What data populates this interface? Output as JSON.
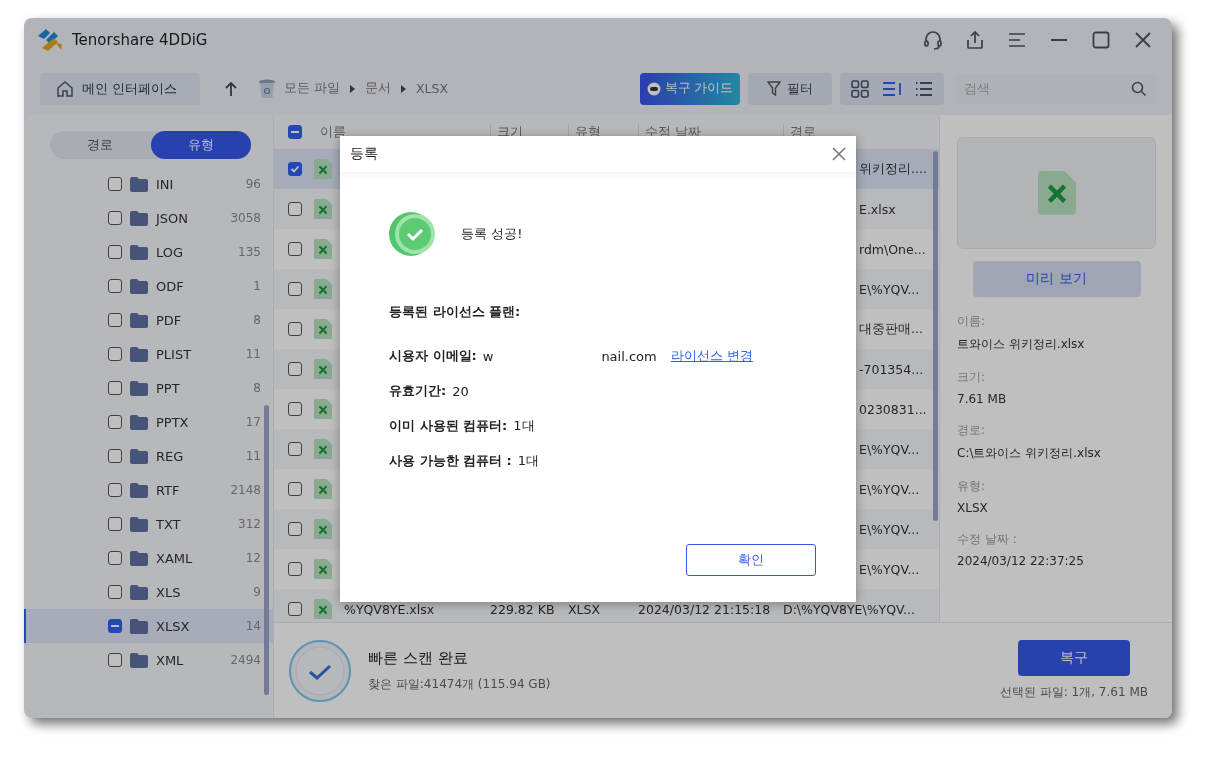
{
  "window": {
    "title": "Tenorshare 4DDiG"
  },
  "toolbar": {
    "home_button": "메인 인터페이스",
    "breadcrumb": [
      "모든 파일",
      "문서",
      "XLSX"
    ],
    "guide_button": "복구 가이드",
    "filter_button": "필터",
    "views": [
      {
        "kind": "grid",
        "selected": false
      },
      {
        "kind": "detail",
        "selected": true
      },
      {
        "kind": "list",
        "selected": false
      }
    ],
    "search": {
      "placeholder": "검색"
    }
  },
  "sidebar": {
    "tabs": [
      {
        "label": "경로",
        "selected": false
      },
      {
        "label": "유형",
        "selected": true
      }
    ],
    "items": [
      {
        "label": "INI",
        "count": "96",
        "checked": false,
        "indeterminate": false,
        "selected": false
      },
      {
        "label": "JSON",
        "count": "3058",
        "checked": false,
        "indeterminate": false,
        "selected": false
      },
      {
        "label": "LOG",
        "count": "135",
        "checked": false,
        "indeterminate": false,
        "selected": false
      },
      {
        "label": "ODF",
        "count": "1",
        "checked": false,
        "indeterminate": false,
        "selected": false
      },
      {
        "label": "PDF",
        "count": "8",
        "checked": false,
        "indeterminate": false,
        "selected": false
      },
      {
        "label": "PLIST",
        "count": "11",
        "checked": false,
        "indeterminate": false,
        "selected": false
      },
      {
        "label": "PPT",
        "count": "8",
        "checked": false,
        "indeterminate": false,
        "selected": false
      },
      {
        "label": "PPTX",
        "count": "17",
        "checked": false,
        "indeterminate": false,
        "selected": false
      },
      {
        "label": "REG",
        "count": "11",
        "checked": false,
        "indeterminate": false,
        "selected": false
      },
      {
        "label": "RTF",
        "count": "2148",
        "checked": false,
        "indeterminate": false,
        "selected": false
      },
      {
        "label": "TXT",
        "count": "312",
        "checked": false,
        "indeterminate": false,
        "selected": false
      },
      {
        "label": "XAML",
        "count": "12",
        "checked": false,
        "indeterminate": false,
        "selected": false
      },
      {
        "label": "XLS",
        "count": "9",
        "checked": false,
        "indeterminate": false,
        "selected": false
      },
      {
        "label": "XLSX",
        "count": "14",
        "checked": false,
        "indeterminate": true,
        "selected": true
      },
      {
        "label": "XML",
        "count": "2494",
        "checked": false,
        "indeterminate": false,
        "selected": false
      }
    ]
  },
  "table": {
    "columns": [
      "이름",
      "크기",
      "유형",
      "수정 날짜",
      "경로"
    ],
    "all_checked": false,
    "all_indeterminate": true,
    "rows": [
      {
        "kind": "covered",
        "checked": true,
        "selected": true,
        "path": "위키정리...."
      },
      {
        "kind": "covered",
        "checked": false,
        "selected": false,
        "path": "E.xlsx"
      },
      {
        "kind": "covered",
        "checked": false,
        "selected": false,
        "path": "rdm\\One..."
      },
      {
        "kind": "covered",
        "checked": false,
        "selected": false,
        "path": "E\\%YQV..."
      },
      {
        "kind": "covered",
        "checked": false,
        "selected": false,
        "path": "대중판매..."
      },
      {
        "kind": "covered",
        "checked": false,
        "selected": false,
        "path": "-701354..."
      },
      {
        "kind": "covered",
        "checked": false,
        "selected": false,
        "path": "0230831..."
      },
      {
        "kind": "covered",
        "checked": false,
        "selected": false,
        "path": "E\\%YQV..."
      },
      {
        "kind": "covered",
        "checked": false,
        "selected": false,
        "path": "E\\%YQV..."
      },
      {
        "kind": "covered",
        "checked": false,
        "selected": false,
        "path": "E\\%YQV..."
      },
      {
        "kind": "covered",
        "checked": false,
        "selected": false,
        "path": "E\\%YQV..."
      },
      {
        "kind": "full",
        "checked": false,
        "selected": false,
        "name": "%YQV8YE.xlsx",
        "size": "229.82 KB",
        "type": "XLSX",
        "modified": "2024/03/12 21:15:18",
        "path": "D:\\%YQV8YE\\%YQV..."
      }
    ]
  },
  "preview": {
    "button": "미리 보기",
    "details": [
      {
        "label": "이름:",
        "value": "트와이스 위키정리.xlsx"
      },
      {
        "label": "크기:",
        "value": "7.61 MB"
      },
      {
        "label": "경로:",
        "value": "C:\\트와이스 위키정리.xlsx"
      },
      {
        "label": "유형:",
        "value": "XLSX"
      },
      {
        "label": "수정 날짜 :",
        "value": "2024/03/12 22:37:25"
      }
    ]
  },
  "status": {
    "title": "빠른 스캔 완료",
    "found": "찾은 파일:41474개 (115.94 GB)",
    "recover_button": "복구",
    "selected_info": "선택된 파일: 1개, 7.61 MB"
  },
  "dialog": {
    "title": "등록",
    "message": "등록 성공!",
    "plan_label": "등록된 라이선스 플랜:",
    "fields": [
      {
        "kind": "email",
        "label": "시용자 이메일:",
        "value_start": "w",
        "value_end": "nail.com",
        "link": "라이선스 변경"
      },
      {
        "kind": "plain",
        "label": "유효기간:",
        "value": "20"
      },
      {
        "kind": "plain",
        "label": "이미 사용된 컴퓨터:",
        "value": "1대"
      },
      {
        "kind": "plain",
        "label": "사용 가능한 컴퓨터 :",
        "value": "1대"
      }
    ],
    "confirm_button": "확인"
  }
}
